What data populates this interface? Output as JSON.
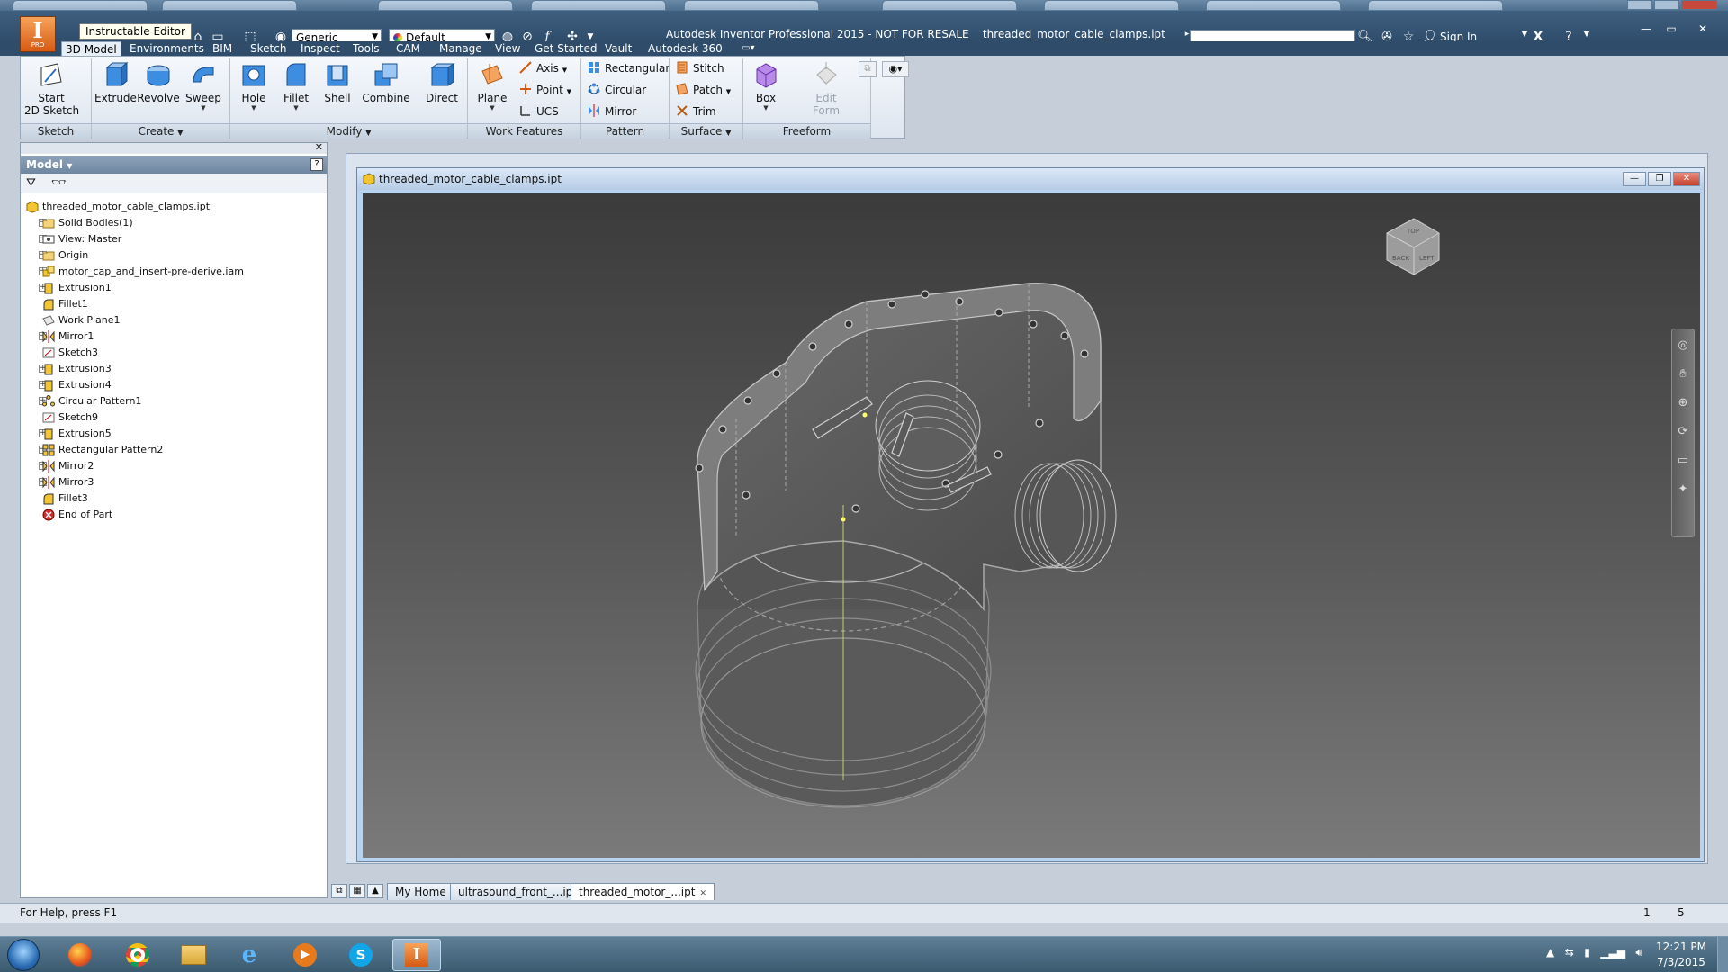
{
  "window": {
    "app_title": "Autodesk Inventor Professional 2015 - NOT FOR RESALE",
    "file_title": "threaded_motor_cable_clamps.ipt",
    "tooltip": "Instructable Editor",
    "sign_in": "Sign In",
    "app_button_pro": "PRO"
  },
  "qat": {
    "material": "Generic",
    "appearance": "Default"
  },
  "ribbon_tabs": [
    "3D Model",
    "Environments",
    "BIM",
    "Sketch",
    "Inspect",
    "Tools",
    "CAM",
    "Manage",
    "View",
    "Get Started",
    "Vault",
    "Autodesk 360"
  ],
  "ribbon": {
    "sketch": {
      "start_line1": "Start",
      "start_line2": "2D Sketch",
      "panel": "Sketch"
    },
    "create": {
      "extrude": "Extrude",
      "revolve": "Revolve",
      "sweep": "Sweep",
      "panel": "Create"
    },
    "modify": {
      "hole": "Hole",
      "fillet": "Fillet",
      "shell": "Shell",
      "combine": "Combine",
      "direct": "Direct",
      "panel": "Modify"
    },
    "work_features": {
      "plane": "Plane",
      "axis": "Axis",
      "point": "Point",
      "ucs": "UCS",
      "panel": "Work Features"
    },
    "pattern": {
      "rectangular": "Rectangular",
      "circular": "Circular",
      "mirror": "Mirror",
      "panel": "Pattern"
    },
    "surface": {
      "stitch": "Stitch",
      "patch": "Patch",
      "trim": "Trim",
      "panel": "Surface"
    },
    "freeform": {
      "box": "Box",
      "edit_line1": "Edit",
      "edit_line2": "Form",
      "panel": "Freeform"
    }
  },
  "browser": {
    "header": "Model",
    "help": "?",
    "tree": [
      {
        "label": "threaded_motor_cable_clamps.ipt",
        "icon": "part-icon",
        "expander": false,
        "indent": 0
      },
      {
        "label": "Solid Bodies(1)",
        "icon": "folder-icon",
        "expander": true,
        "indent": 1
      },
      {
        "label": "View: Master",
        "icon": "view-icon",
        "expander": true,
        "indent": 1
      },
      {
        "label": "Origin",
        "icon": "folder-icon",
        "expander": true,
        "indent": 1
      },
      {
        "label": "motor_cap_and_insert-pre-derive.iam",
        "icon": "assembly-icon",
        "expander": true,
        "indent": 1
      },
      {
        "label": "Extrusion1",
        "icon": "extrusion-icon",
        "expander": true,
        "indent": 1
      },
      {
        "label": "Fillet1",
        "icon": "fillet-icon",
        "expander": false,
        "indent": 1
      },
      {
        "label": "Work Plane1",
        "icon": "workplane-icon",
        "expander": false,
        "indent": 1
      },
      {
        "label": "Mirror1",
        "icon": "mirror-icon",
        "expander": true,
        "indent": 1
      },
      {
        "label": "Sketch3",
        "icon": "sketch-icon",
        "expander": false,
        "indent": 1
      },
      {
        "label": "Extrusion3",
        "icon": "extrusion-icon",
        "expander": true,
        "indent": 1
      },
      {
        "label": "Extrusion4",
        "icon": "extrusion-icon",
        "expander": true,
        "indent": 1
      },
      {
        "label": "Circular Pattern1",
        "icon": "circular-pattern-icon",
        "expander": true,
        "indent": 1
      },
      {
        "label": "Sketch9",
        "icon": "sketch-icon",
        "expander": false,
        "indent": 1
      },
      {
        "label": "Extrusion5",
        "icon": "extrusion-icon",
        "expander": true,
        "indent": 1
      },
      {
        "label": "Rectangular Pattern2",
        "icon": "rect-pattern-icon",
        "expander": true,
        "indent": 1
      },
      {
        "label": "Mirror2",
        "icon": "mirror-icon",
        "expander": true,
        "indent": 1
      },
      {
        "label": "Mirror3",
        "icon": "mirror-icon",
        "expander": true,
        "indent": 1
      },
      {
        "label": "Fillet3",
        "icon": "fillet-icon",
        "expander": false,
        "indent": 1
      },
      {
        "label": "End of Part",
        "icon": "end-of-part-icon",
        "expander": false,
        "indent": 1
      }
    ]
  },
  "document": {
    "title": "threaded_motor_cable_clamps.ipt",
    "viewcube_labels": [
      "BACK",
      "LEFT",
      "TOP"
    ]
  },
  "doc_tabs": [
    "My Home",
    "ultrasound_front_...ipt",
    "threaded_motor_...ipt"
  ],
  "status": {
    "help": "For Help, press F1",
    "count1": "1",
    "count2": "5"
  },
  "taskbar": {
    "time": "12:21 PM",
    "date": "7/3/2015"
  },
  "colors": {
    "title_bar": "#2f4d6b",
    "app_button": "#e8741e",
    "viewport_top": "#3b3b3b",
    "viewport_bottom": "#7a7a7a"
  }
}
